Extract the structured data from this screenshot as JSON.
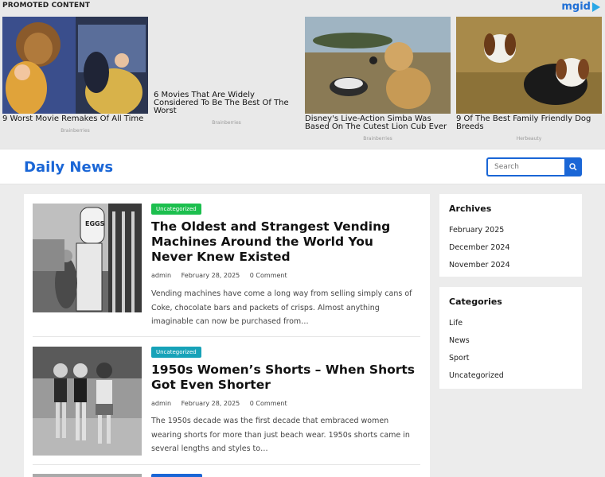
{
  "promo": {
    "label": "PROMOTED CONTENT",
    "brand": "mgid",
    "cards": [
      {
        "title": "9 Worst Movie Remakes Of All Time",
        "source": "Brainberries"
      },
      {
        "title": "6 Movies That Are Widely Considered To Be The Best Of The Worst",
        "source": "Brainberries"
      },
      {
        "title": "Disney's Live-Action Simba Was Based On The Cutest Lion Cub Ever",
        "source": "Brainberries"
      },
      {
        "title": "9 Of The Best Family Friendly Dog Breeds",
        "source": "Herbeauty"
      }
    ]
  },
  "header": {
    "site_title": "Daily News",
    "search_placeholder": "Search"
  },
  "posts": [
    {
      "category": "Uncategorized",
      "title": "The Oldest and Strangest Vending Machines Around the World You Never Knew Existed",
      "author": "admin",
      "date": "February 28, 2025",
      "comments": "0 Comment",
      "excerpt": "Vending machines have come a long way from selling simply cans of Coke, chocolate bars and packets of crisps. Almost anything imaginable can now be purchased from…"
    },
    {
      "category": "Uncategorized",
      "title": "1950s Women’s Shorts – When Shorts Got Even Shorter",
      "author": "admin",
      "date": "February 28, 2025",
      "comments": "0 Comment",
      "excerpt": "The 1950s decade was the first decade that embraced women wearing shorts for more than just beach wear. 1950s shorts came in several lengths and styles to…"
    }
  ],
  "sidebar": {
    "archives_title": "Archives",
    "archives": [
      "February 2025",
      "December 2024",
      "November 2024"
    ],
    "categories_title": "Categories",
    "categories": [
      "Life",
      "News",
      "Sport",
      "Uncategorized"
    ]
  },
  "colors": {
    "accent": "#1a66d6",
    "badge1": "#1cbf4e",
    "badge2": "#17a2b8"
  }
}
